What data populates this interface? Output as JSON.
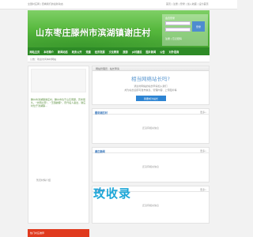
{
  "topbar": {
    "left_text": "全国村庄网 | 查看我们的最新动态",
    "right_text": "首页 | 注册 | 登录 | 加入收藏 | 设为首页"
  },
  "banner": {
    "title": "山东枣庄滕州市滨湖镇谢庄村",
    "login_label": "会员登录",
    "login_button": "登录",
    "login_links": "注册 | 忘记密码"
  },
  "nav": {
    "items": [
      "网站主页",
      "本村简介",
      "新闻动态",
      "政务公开",
      "党建",
      "经济发展",
      "文化教育",
      "旅游",
      "乡村建设",
      "图片新闻",
      "公告",
      "对外招商",
      "乡镇信息",
      "村务论坛"
    ]
  },
  "sub": {
    "text": "公告：欢迎访问本村网站"
  },
  "left": {
    "para": "滕州市滨湖镇谢庄村，滕州市位于山东南部，历史悠久，“文明之邦”，“王国故都”，历代名人辈出，谢庄村位于滨湖镇...",
    "empty_text": "暂无村情介绍"
  },
  "hero": {
    "header": "网站管理员 · 站长申请",
    "question": "相当网络站长吗?",
    "desc1": "通过村网站的站长申请加入我们",
    "desc2": "成为站长后即可发布信息、管理内容、上传图片等",
    "apply_button": "我要成为站长"
  },
  "sections": [
    {
      "title": "图说谢庄村",
      "more": "更多»",
      "empty": "还没有相关信息"
    },
    {
      "title": "谢庄新闻",
      "more": "更多»",
      "empty": "还没有相关信息"
    },
    {
      "title": "村务公开",
      "more": "更多»",
      "empty": "还没有相关信息"
    }
  ],
  "watermark": "玫收录",
  "footer": {
    "text": "热门村庄推荐"
  }
}
